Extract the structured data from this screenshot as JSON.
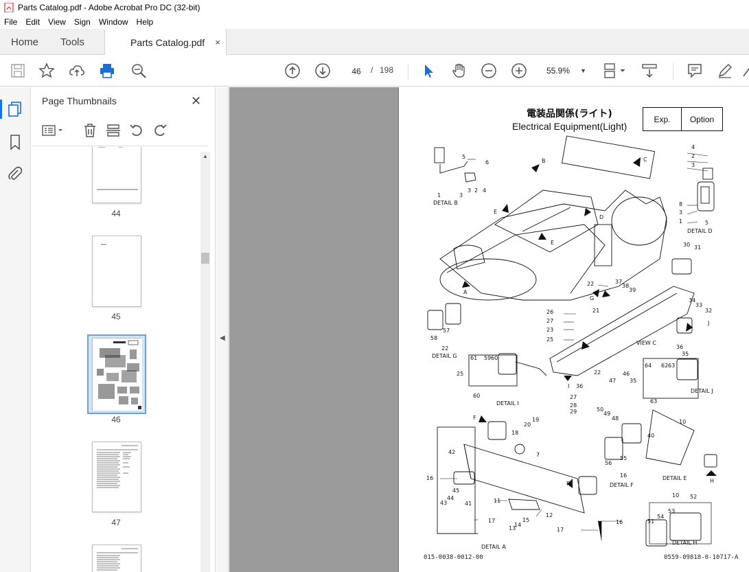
{
  "window": {
    "title": "Parts Catalog.pdf - Adobe Acrobat Pro DC (32-bit)"
  },
  "menu": [
    "File",
    "Edit",
    "View",
    "Sign",
    "Window",
    "Help"
  ],
  "tabs": {
    "home": "Home",
    "tools": "Tools",
    "document": "Parts Catalog.pdf",
    "close": "×"
  },
  "toolbar": {
    "current_page": "46",
    "separator": "/",
    "total_pages": "198",
    "zoom": "55.9%"
  },
  "panel": {
    "title": "Page Thumbnails",
    "close": "✕",
    "thumbnails": [
      {
        "label": "44"
      },
      {
        "label": "45"
      },
      {
        "label": "46",
        "selected": true
      },
      {
        "label": "47"
      }
    ]
  },
  "document": {
    "title_jp": "電装品関係(ライト)",
    "title_en": "Electrical Equipment(Light)",
    "badge_exp": "Exp.",
    "badge_option": "Option",
    "footer_left": "015-0038-0012-00",
    "footer_right": "0559-09818-0-10717-A",
    "detail_labels": [
      "DETAIL  B",
      "DETAIL  D",
      "DETAIL  G",
      "VIEW  C",
      "DETAIL  I",
      "DETAIL  J",
      "DETAIL  E",
      "DETAIL  F",
      "DETAIL  A",
      "DETAIL  H"
    ],
    "arrow_letters": [
      "B",
      "C",
      "E",
      "D",
      "E",
      "A",
      "G",
      "I",
      "J",
      "F",
      "F",
      "H"
    ],
    "part_numbers": [
      "5",
      "6",
      "1",
      "3",
      "3",
      "2",
      "4",
      "4",
      "2",
      "3",
      "8",
      "3",
      "1",
      "5",
      "30",
      "31",
      "22",
      "37",
      "38",
      "39",
      "21",
      "34",
      "33",
      "32",
      "26",
      "27",
      "23",
      "25",
      "57",
      "58",
      "22",
      "61",
      "59",
      "60",
      "25",
      "60",
      "22",
      "36",
      "46",
      "47",
      "36",
      "35",
      "64",
      "62",
      "63",
      "35",
      "63",
      "27",
      "28",
      "29",
      "50",
      "49",
      "48",
      "18",
      "20",
      "19",
      "7",
      "42",
      "16",
      "45",
      "44",
      "43",
      "41",
      "11",
      "12",
      "15",
      "14",
      "13",
      "17",
      "17",
      "16",
      "40",
      "10",
      "55",
      "56",
      "16",
      "10",
      "52",
      "53",
      "54",
      "51"
    ]
  }
}
